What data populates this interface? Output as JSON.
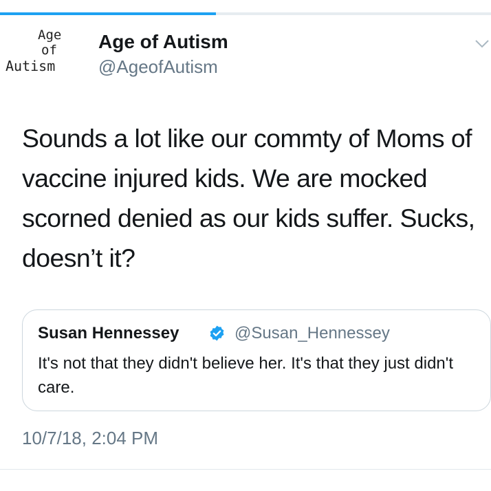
{
  "progress": {
    "fraction": 0.44
  },
  "author": {
    "logo_lines": [
      "Age",
      "of",
      "Autism"
    ],
    "display_name": "Age of Autism",
    "handle": "@AgeofAutism"
  },
  "tweet": {
    "text": "Sounds a lot like our commty of Moms of vaccine injured kids. We are mocked scorned denied as our kids suffer. Sucks, doesn’t it?",
    "timestamp": "10/7/18, 2:04 PM"
  },
  "quoted_tweet": {
    "display_name": "Susan Hennessey",
    "verified": true,
    "handle": "@Susan_Hennessey",
    "text": "It's not that they didn't believe her. It's that they just didn't care."
  },
  "icons": {
    "menu": "chevron-down-icon",
    "verified": "verified-badge-icon"
  },
  "colors": {
    "accent": "#1da1f2",
    "secondary_text": "#657786",
    "border": "#ccd6dd"
  }
}
